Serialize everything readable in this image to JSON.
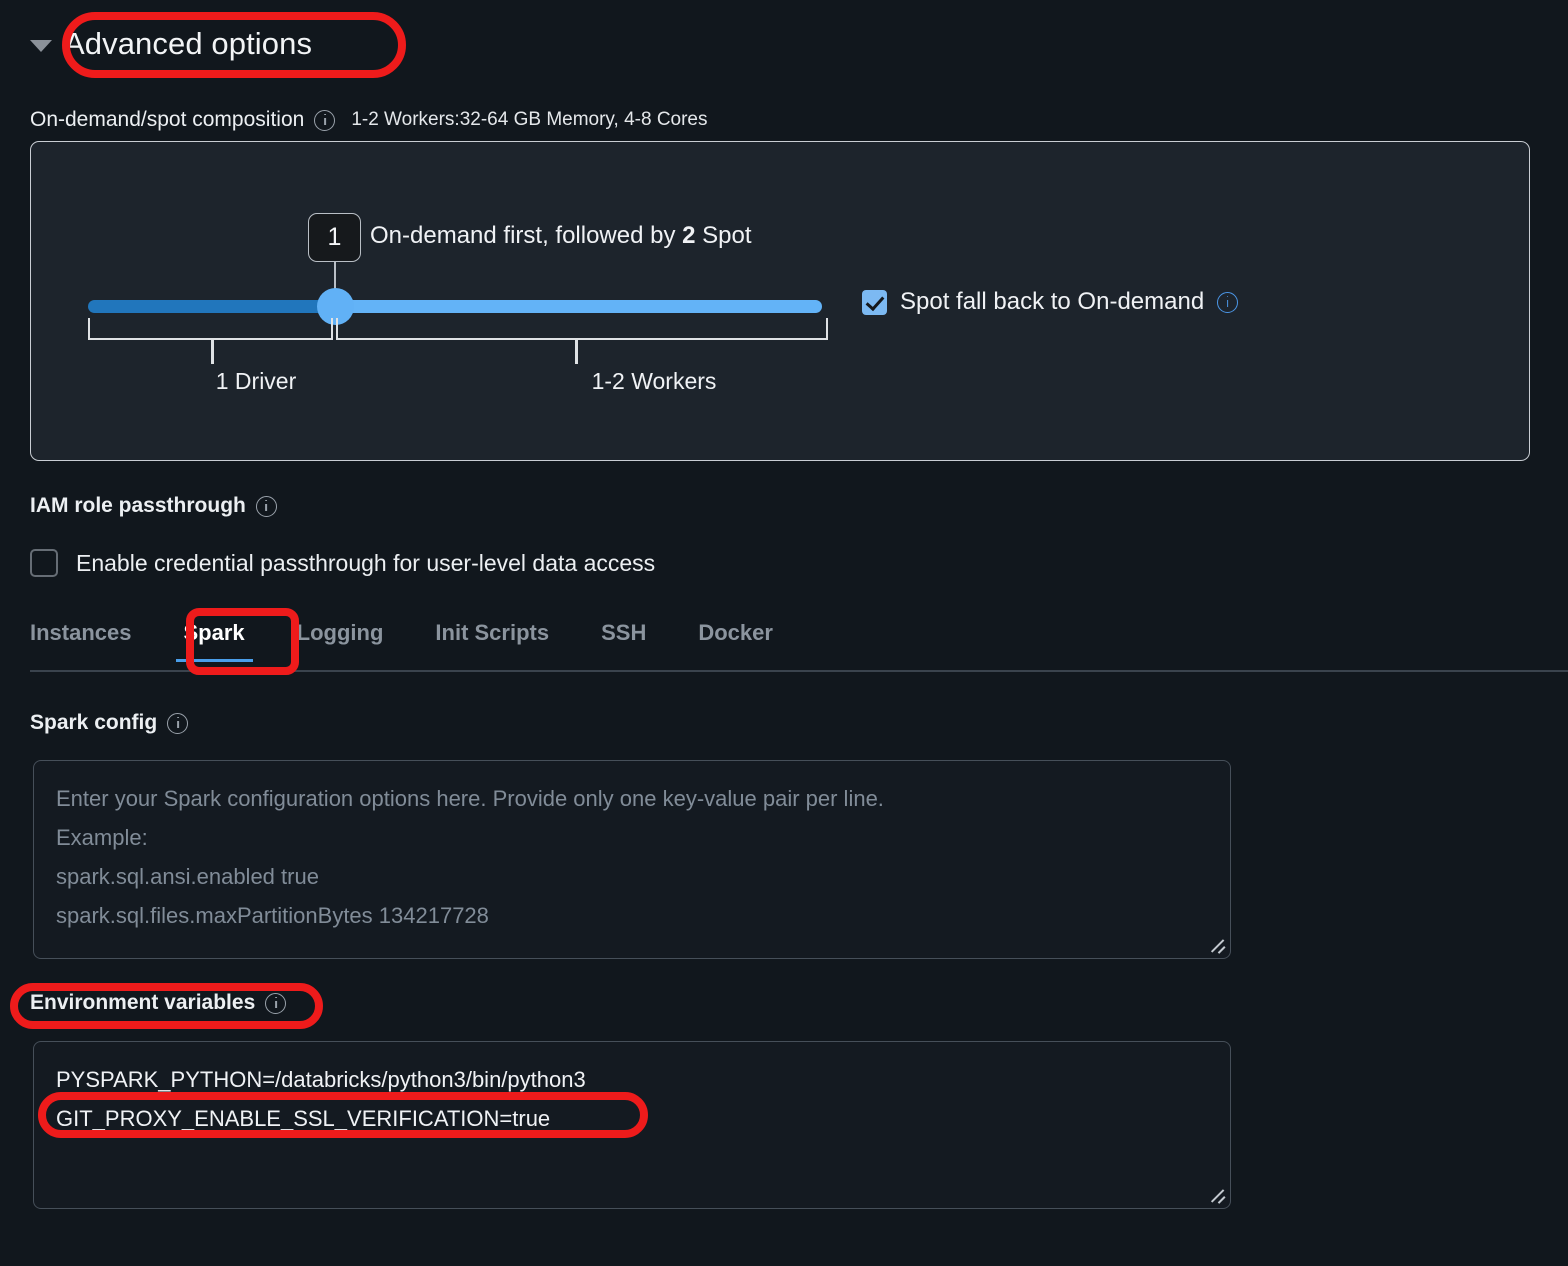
{
  "advanced_options": {
    "title": "Advanced options",
    "caret_icon": "chevron-down-icon"
  },
  "composition": {
    "label": "On-demand/spot composition",
    "info_icon": "info-icon",
    "summary": "1-2 Workers:32-64 GB Memory, 4-8 Cores",
    "slider": {
      "badge_value": "1",
      "callout_prefix": "On-demand first, followed by ",
      "callout_count": "2",
      "callout_suffix": " Spot",
      "left_bracket_label": "1 Driver",
      "right_bracket_label": "1-2 Workers",
      "track_left_color": "#2176bc",
      "track_right_color": "#63b3f7",
      "thumb_color": "#61b1f6"
    },
    "spot_fallback": {
      "label": "Spot fall back to On-demand",
      "checked": true,
      "checkbox_color": "#7cb9f2",
      "info_icon": "info-icon"
    }
  },
  "iam": {
    "label": "IAM role passthrough",
    "info_icon": "info-icon",
    "checkbox_label": "Enable credential passthrough for user-level data access",
    "checked": false
  },
  "tabs": {
    "items": [
      {
        "label": "Instances",
        "active": false
      },
      {
        "label": "Spark",
        "active": true
      },
      {
        "label": "Logging",
        "active": false
      },
      {
        "label": "Init Scripts",
        "active": false
      },
      {
        "label": "SSH",
        "active": false
      },
      {
        "label": "Docker",
        "active": false
      }
    ],
    "active_underline_color": "#4a9eea"
  },
  "spark_config": {
    "label": "Spark config",
    "info_icon": "info-icon",
    "value": "",
    "placeholder_lines": [
      "Enter your Spark configuration options here. Provide only one key-value pair per line.",
      "Example:",
      "spark.sql.ansi.enabled true",
      "spark.sql.files.maxPartitionBytes 134217728"
    ]
  },
  "environment_variables": {
    "label": "Environment variables",
    "info_icon": "info-icon",
    "value_lines": [
      "PYSPARK_PYTHON=/databricks/python3/bin/python3",
      "GIT_PROXY_ENABLE_SSL_VERIFICATION=true"
    ]
  },
  "annotations": {
    "color": "#ee1b1b",
    "targets": [
      "advanced-options-title",
      "spark-tab",
      "environment-variables-label",
      "git-proxy-env-line"
    ]
  }
}
